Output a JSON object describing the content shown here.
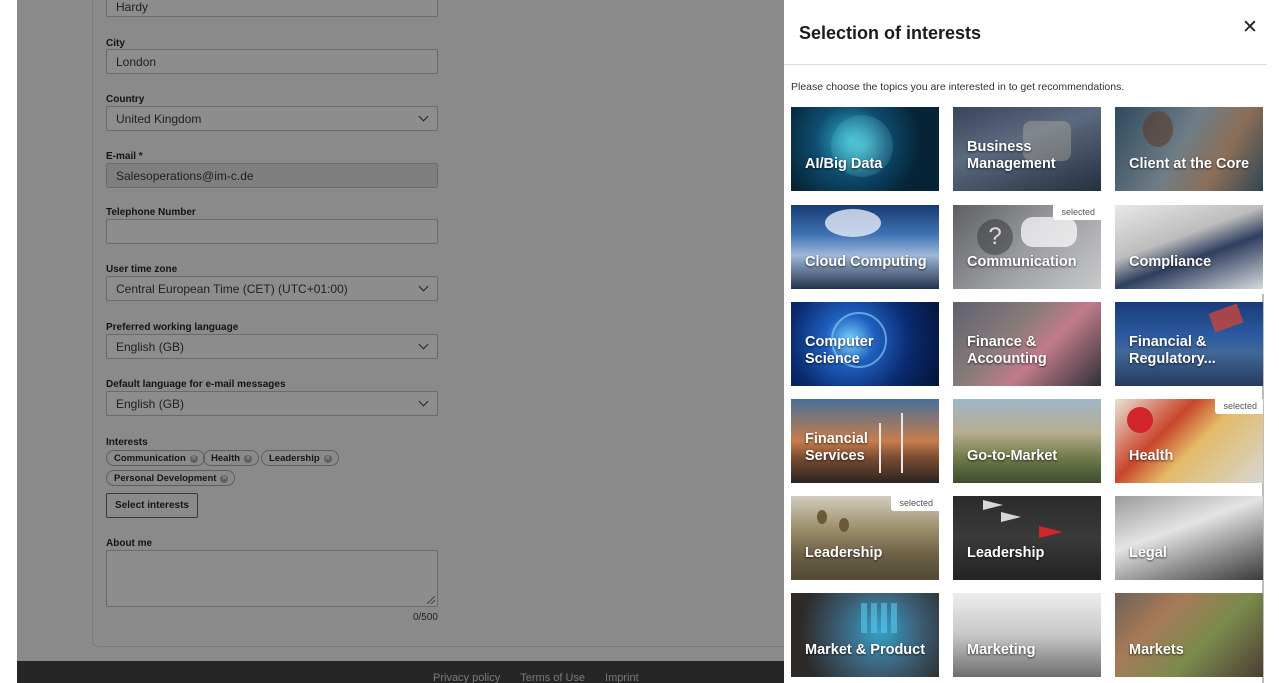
{
  "form": {
    "top_value": "Hardy",
    "city_label": "City",
    "city_value": "London",
    "country_label": "Country",
    "country_value": "United Kingdom",
    "email_label": "E-mail *",
    "email_value": "Salesoperations@im-c.de",
    "phone_label": "Telephone Number",
    "phone_value": "",
    "timezone_label": "User time zone",
    "timezone_value": "Central European Time (CET) (UTC+01:00)",
    "working_language_label": "Preferred working language",
    "working_language_value": "English (GB)",
    "email_language_label": "Default language for e-mail messages",
    "email_language_value": "English (GB)",
    "interests_label": "Interests",
    "interests": [
      "Communication",
      "Health",
      "Leadership",
      "Personal Development"
    ],
    "select_interests_label": "Select interests",
    "about_label": "About me",
    "about_value": "",
    "char_count": "0/500"
  },
  "footer": {
    "links": [
      "Privacy policy",
      "Terms of Use",
      "Imprint"
    ]
  },
  "panel": {
    "title": "Selection of interests",
    "close_glyph": "✕",
    "intro": "Please choose the topics you are interested in to get recommendations.",
    "selected_badge": "selected",
    "tiles": [
      {
        "label": "AI/Big Data",
        "selected": false
      },
      {
        "label": "Business Management",
        "selected": false
      },
      {
        "label": "Client at the Core",
        "selected": false
      },
      {
        "label": "Cloud Computing",
        "selected": false
      },
      {
        "label": "Communication",
        "selected": true
      },
      {
        "label": "Compliance",
        "selected": false
      },
      {
        "label": "Computer Science",
        "selected": false
      },
      {
        "label": "Finance & Accounting",
        "selected": false
      },
      {
        "label": "Financial & Regulatory...",
        "selected": false
      },
      {
        "label": "Financial Services",
        "selected": false
      },
      {
        "label": "Go-to-Market",
        "selected": false
      },
      {
        "label": "Health",
        "selected": true
      },
      {
        "label": "Leadership",
        "selected": true
      },
      {
        "label": "Leadership",
        "selected": false
      },
      {
        "label": "Legal",
        "selected": false
      },
      {
        "label": "Market & Product",
        "selected": false
      },
      {
        "label": "Marketing",
        "selected": false
      },
      {
        "label": "Markets",
        "selected": false
      }
    ]
  }
}
